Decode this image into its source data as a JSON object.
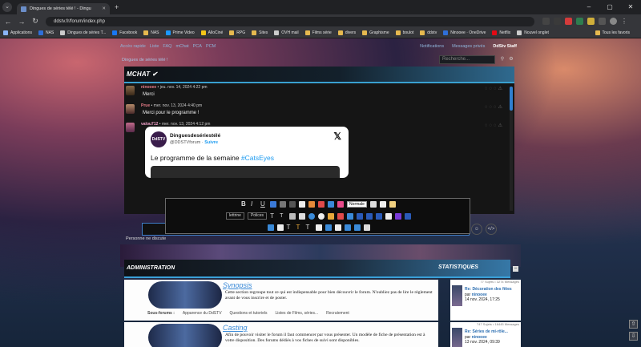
{
  "browser": {
    "tab_title": "Dingues de séries télé ! - Dingu",
    "url": "ddstv.fr/forum/index.php",
    "bookmarks": [
      "Applications",
      "NAS",
      "Dingues de séries T...",
      "Facebook",
      "NAS",
      "Prime Video",
      "AlloCiné",
      "RPG",
      "Sites",
      "OVH mail",
      "Films série",
      "divers",
      "Graphisme",
      "boulot",
      "ddstv",
      "Ninooee · OneDrive",
      "Netflix",
      "Nouvel onglet"
    ],
    "all_bookmarks": "Tous les favoris"
  },
  "forum": {
    "nav_left": [
      "Accès rapide",
      "Liste",
      "FAQ",
      "mChat",
      "PCA",
      "PCM"
    ],
    "nav_right": [
      "Notifications",
      "Messages privés",
      "DdStv Staff"
    ],
    "breadcrumb": "Dingues de séries télé !",
    "search_placeholder": "Recherche..."
  },
  "mchat": {
    "title": "MCHAT ✔",
    "messages": [
      {
        "user": "ninooee",
        "date": "jeu. nov. 14, 2024 4:22 pm",
        "text": "Merci"
      },
      {
        "user": "Prue",
        "date": "mer. nov. 13, 2024 4:40 pm",
        "text": "Merci pour le programme !"
      },
      {
        "user": "valou712",
        "date": "mer. nov. 13, 2024 4:12 pm",
        "text": ""
      }
    ],
    "tweet": {
      "avatar": "DdSTV",
      "name": "Dinguesdesériestélé",
      "handle": "@DDSTVforum",
      "follow": "Suivre",
      "text": "Le programme de la semaine",
      "hashtag": "#CatsEyes"
    },
    "toolbar": {
      "size_select": "Normale",
      "label1": "lettrine",
      "label2": "Polices"
    },
    "nobody": "Personne ne discute"
  },
  "admin": {
    "title": "ADMINISTRATION",
    "stats_title": "STATISTIQUES",
    "categories": [
      {
        "title": "Synopsis",
        "desc": "Cette section regroupe tout ce qui est indispensable pour bien découvrir le forum. N'oubliez pas de lire le règlement avant de vous inscrire et de poster.",
        "subforums_label": "Sous-forums :",
        "subforums": [
          "Apparence du DdSTV",
          "Questions et tutoriels",
          "Listes de Films, séries...",
          "Recrutement"
        ]
      },
      {
        "title": "Casting",
        "desc": "Afin de pouvoir visiter le forum il faut commencer par vous présenter. Un modèle de fiche de présentation est à votre disposition. Des forums dédiés à vos fiches de suivi sont disponibles.",
        "subforums_label": "",
        "subforums": []
      }
    ],
    "stats": [
      {
        "meta": "77 Sujets • 3274 Messages",
        "title": "Re: Décoration des fêtes",
        "by": "par",
        "user": "ninooee",
        "date": "14 nov. 2024, 17:25"
      },
      {
        "meta": "747 Sujets • 16445 Messages",
        "title": "Re: Séries de mi-rôle...",
        "by": "par",
        "user": "ninooee",
        "date": "13 nov. 2024, 09:39"
      }
    ]
  }
}
